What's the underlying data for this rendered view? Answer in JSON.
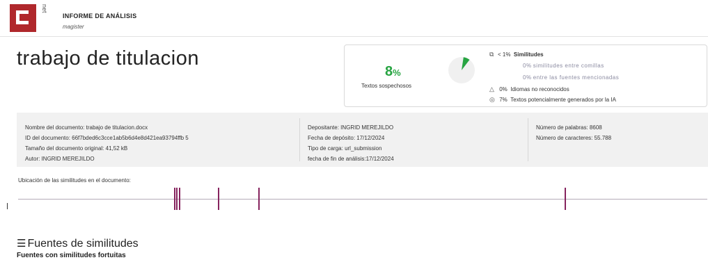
{
  "header": {
    "logo_text": "net",
    "title": "INFORME DE ANÁLISIS",
    "subtitle": "magister"
  },
  "document_title": "trabajo de titulacion",
  "summary": {
    "percent_value": "8",
    "percent_sign": "%",
    "percent_label": "Textos sospechosos",
    "donut_fraction": 0.08,
    "donut_color": "#27a442",
    "metrics": [
      {
        "icon": "copy-icon",
        "glyph": "⧉",
        "value": "< 1%",
        "label": "Similitudes"
      },
      {
        "icon": "",
        "glyph": "",
        "value": "0%",
        "label": "similitudes entre comillas"
      },
      {
        "icon": "",
        "glyph": "",
        "value": "0%",
        "label": "entre las fuentes mencionadas"
      },
      {
        "icon": "warning-icon",
        "glyph": "△",
        "value": "0%",
        "label": "Idiomas no reconocidos"
      },
      {
        "icon": "ai-icon",
        "glyph": "◎",
        "value": "7%",
        "label": "Textos potencialmente generados por la IA"
      }
    ]
  },
  "info": {
    "col1": [
      "Nombre del documento: trabajo de titulacion.docx",
      "ID del documento: 66f7bded6c3cce1ab5b6d4e8d421ea93794ffb 5",
      "Tamaño del documento original: 41,52 kB",
      "Autor: INGRID MEREJILDO"
    ],
    "col2": [
      "Depositante: INGRID MEREJILDO",
      "Fecha de depósito: 17/12/2024",
      "Tipo de carga: url_submission",
      "fecha de fin de análisis:17/12/2024"
    ],
    "col3": [
      "Número de palabras: 8608",
      "Número de caracteres: 55.788"
    ]
  },
  "ubicacion_label": "Ubicación de las similitudes en el documento:",
  "similarity_positions": [
    0.226,
    0.229,
    0.233,
    0.29,
    0.348,
    0.793
  ],
  "mark_color": "#86235e",
  "sources_section": {
    "icon": "list-icon",
    "glyph": "☰",
    "title": "Fuentes de similitudes",
    "subtitle": "Fuentes con similitudes fortuitas"
  }
}
